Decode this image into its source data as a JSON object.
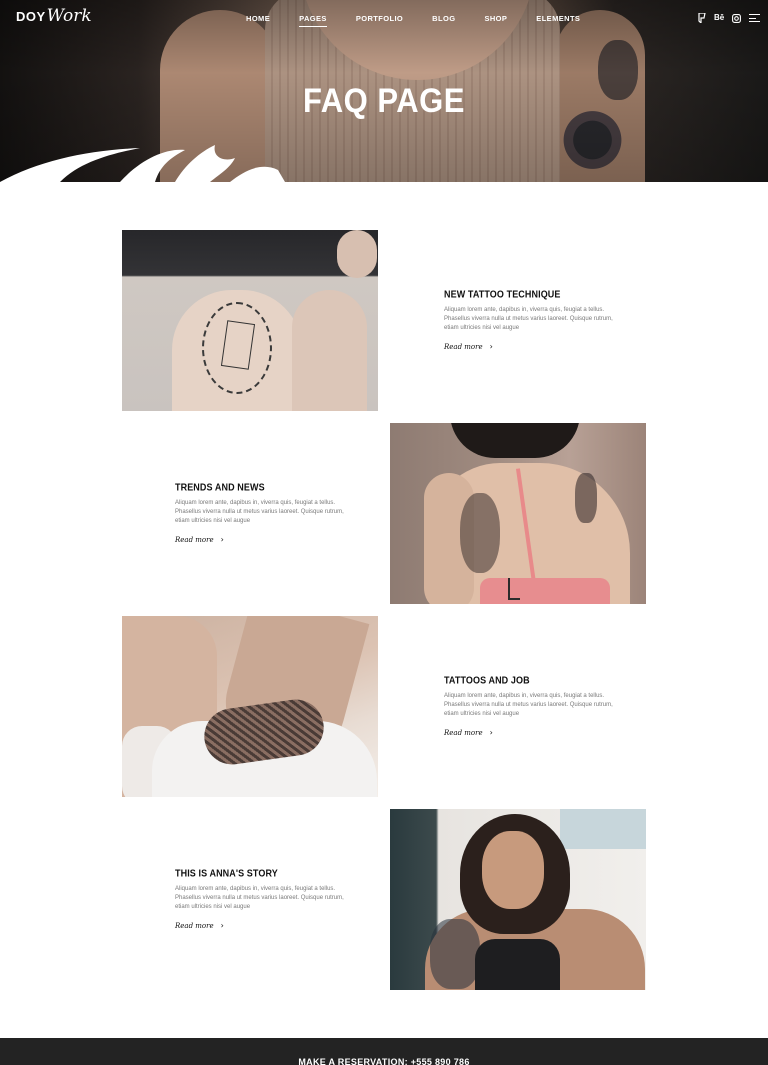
{
  "brand": {
    "logo_main": "DOY",
    "logo_script": "Work"
  },
  "nav": {
    "items": [
      "HOME",
      "PAGES",
      "PORTFOLIO",
      "BLOG",
      "SHOP",
      "ELEMENTS"
    ],
    "active": "PAGES"
  },
  "header_tools": {
    "icon1": "foursquare-icon",
    "icon2_label": "Bē",
    "icon3": "instagram-icon",
    "icon4": "menu-icon"
  },
  "hero": {
    "title": "FAQ PAGE"
  },
  "faq": [
    {
      "title": "NEW TATTOO TECHNIQUE",
      "body": "Aliquam lorem ante, dapibus in, viverra quis, feugiat a tellus. Phasellus viverra nulla ut metus varius laoreet. Quisque rutrum, etiam ultricies nisi vel augue",
      "more": "Read more"
    },
    {
      "title": "TRENDS AND NEWS",
      "body": "Aliquam lorem ante, dapibus in, viverra quis, feugiat a tellus. Phasellus viverra nulla ut metus varius laoreet. Quisque rutrum, etiam ultricies nisi vel augue",
      "more": "Read more"
    },
    {
      "title": "TATTOOS AND JOB",
      "body": "Aliquam lorem ante, dapibus in, viverra quis, feugiat a tellus. Phasellus viverra nulla ut metus varius laoreet. Quisque rutrum, etiam ultricies nisi vel augue",
      "more": "Read more"
    },
    {
      "title": "THIS IS ANNA'S STORY",
      "body": "Aliquam lorem ante, dapibus in, viverra quis, feugiat a tellus. Phasellus viverra nulla ut metus varius laoreet. Quisque rutrum, etiam ultricies nisi vel augue",
      "more": "Read more"
    }
  ],
  "footer": {
    "reservation": "MAKE A RESERVATION: +555 890 786"
  },
  "colors": {
    "text": "#111111",
    "muted": "#7a7a7a",
    "footer_bg": "#232323"
  }
}
